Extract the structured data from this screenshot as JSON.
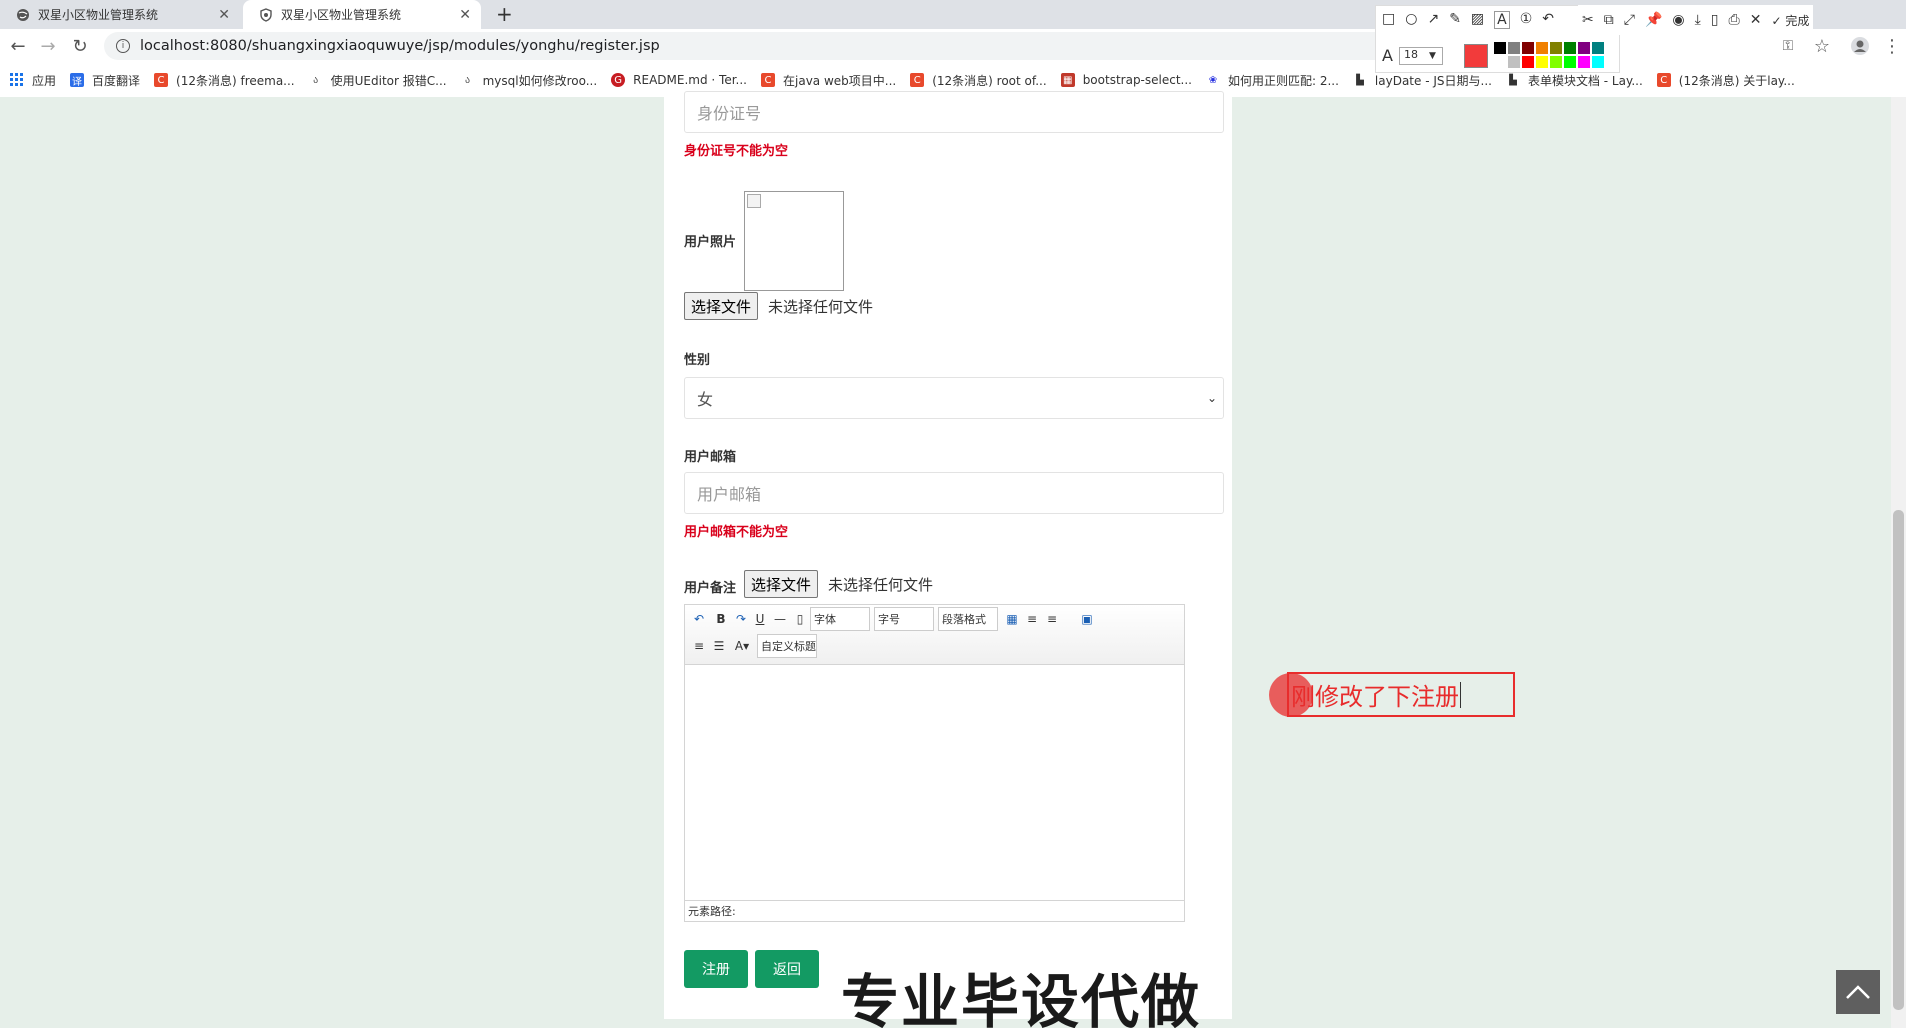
{
  "tabs": [
    {
      "title": "双星小区物业管理系统"
    },
    {
      "title": "双星小区物业管理系统"
    }
  ],
  "address": {
    "url": "localhost:8080/shuangxingxiaoquwuye/jsp/modules/yonghu/register.jsp"
  },
  "bookmarks": [
    {
      "label": "应用",
      "icon": "apps-grid-icon",
      "color": "#1a73e8"
    },
    {
      "label": "百度翻译",
      "icon": "baidu-translate-icon",
      "color": "#2b6de8"
    },
    {
      "label": "(12条消息) freema...",
      "icon": "csdn-icon",
      "color": "#e8492c"
    },
    {
      "label": "使用UEditor 报错C...",
      "icon": "bookmark-icon",
      "color": "#555555"
    },
    {
      "label": "mysql如何修改roo...",
      "icon": "bookmark-icon",
      "color": "#555555"
    },
    {
      "label": "README.md · Ter...",
      "icon": "gitee-icon",
      "color": "#c71d23"
    },
    {
      "label": "在java web项目中...",
      "icon": "csdn-icon",
      "color": "#e8492c"
    },
    {
      "label": "(12条消息) root of...",
      "icon": "csdn-icon",
      "color": "#e8492c"
    },
    {
      "label": "bootstrap-select...",
      "icon": "bookmark-icon",
      "color": "#c0392b"
    },
    {
      "label": "如何用正则匹配: 2...",
      "icon": "baidu-icon",
      "color": "#2932e1"
    },
    {
      "label": "layDate - JS日期与...",
      "icon": "layui-icon",
      "color": "#333333"
    },
    {
      "label": "表单模块文档 - Lay...",
      "icon": "layui-icon",
      "color": "#333333"
    },
    {
      "label": "(12条消息) 关于lay...",
      "icon": "csdn-icon",
      "color": "#e8492c"
    }
  ],
  "shot_toolbar": {
    "font_size": "18",
    "done_label": "完成",
    "current_color": "#f23b3b",
    "palette": [
      "#000000",
      "#808080",
      "#800000",
      "#f08000",
      "#808000",
      "#008000",
      "#800080",
      "#008080",
      "#ffffff",
      "#c0c0c0",
      "#ff0000",
      "#ffff00",
      "#80ff00",
      "#00ff00",
      "#ff00ff",
      "#00ffff"
    ]
  },
  "form": {
    "idcard_placeholder": "身份证号",
    "idcard_error": "身份证号不能为空",
    "photo_label": "用户照片",
    "file_button": "选择文件",
    "file_none": "未选择任何文件",
    "gender_label": "性别",
    "gender_value": "女",
    "email_label": "用户邮箱",
    "email_placeholder": "用户邮箱",
    "email_error": "用户邮箱不能为空",
    "remark_label": "用户备注",
    "editor": {
      "font_family": "字体",
      "font_size": "字号",
      "paragraph": "段落格式",
      "custom_title": "自定义标题",
      "path_label": "元素路径:"
    },
    "register_button": "注册",
    "back_button": "返回"
  },
  "annotation_text": "刚修改了下注册",
  "watermark_text": "专业毕设代做"
}
